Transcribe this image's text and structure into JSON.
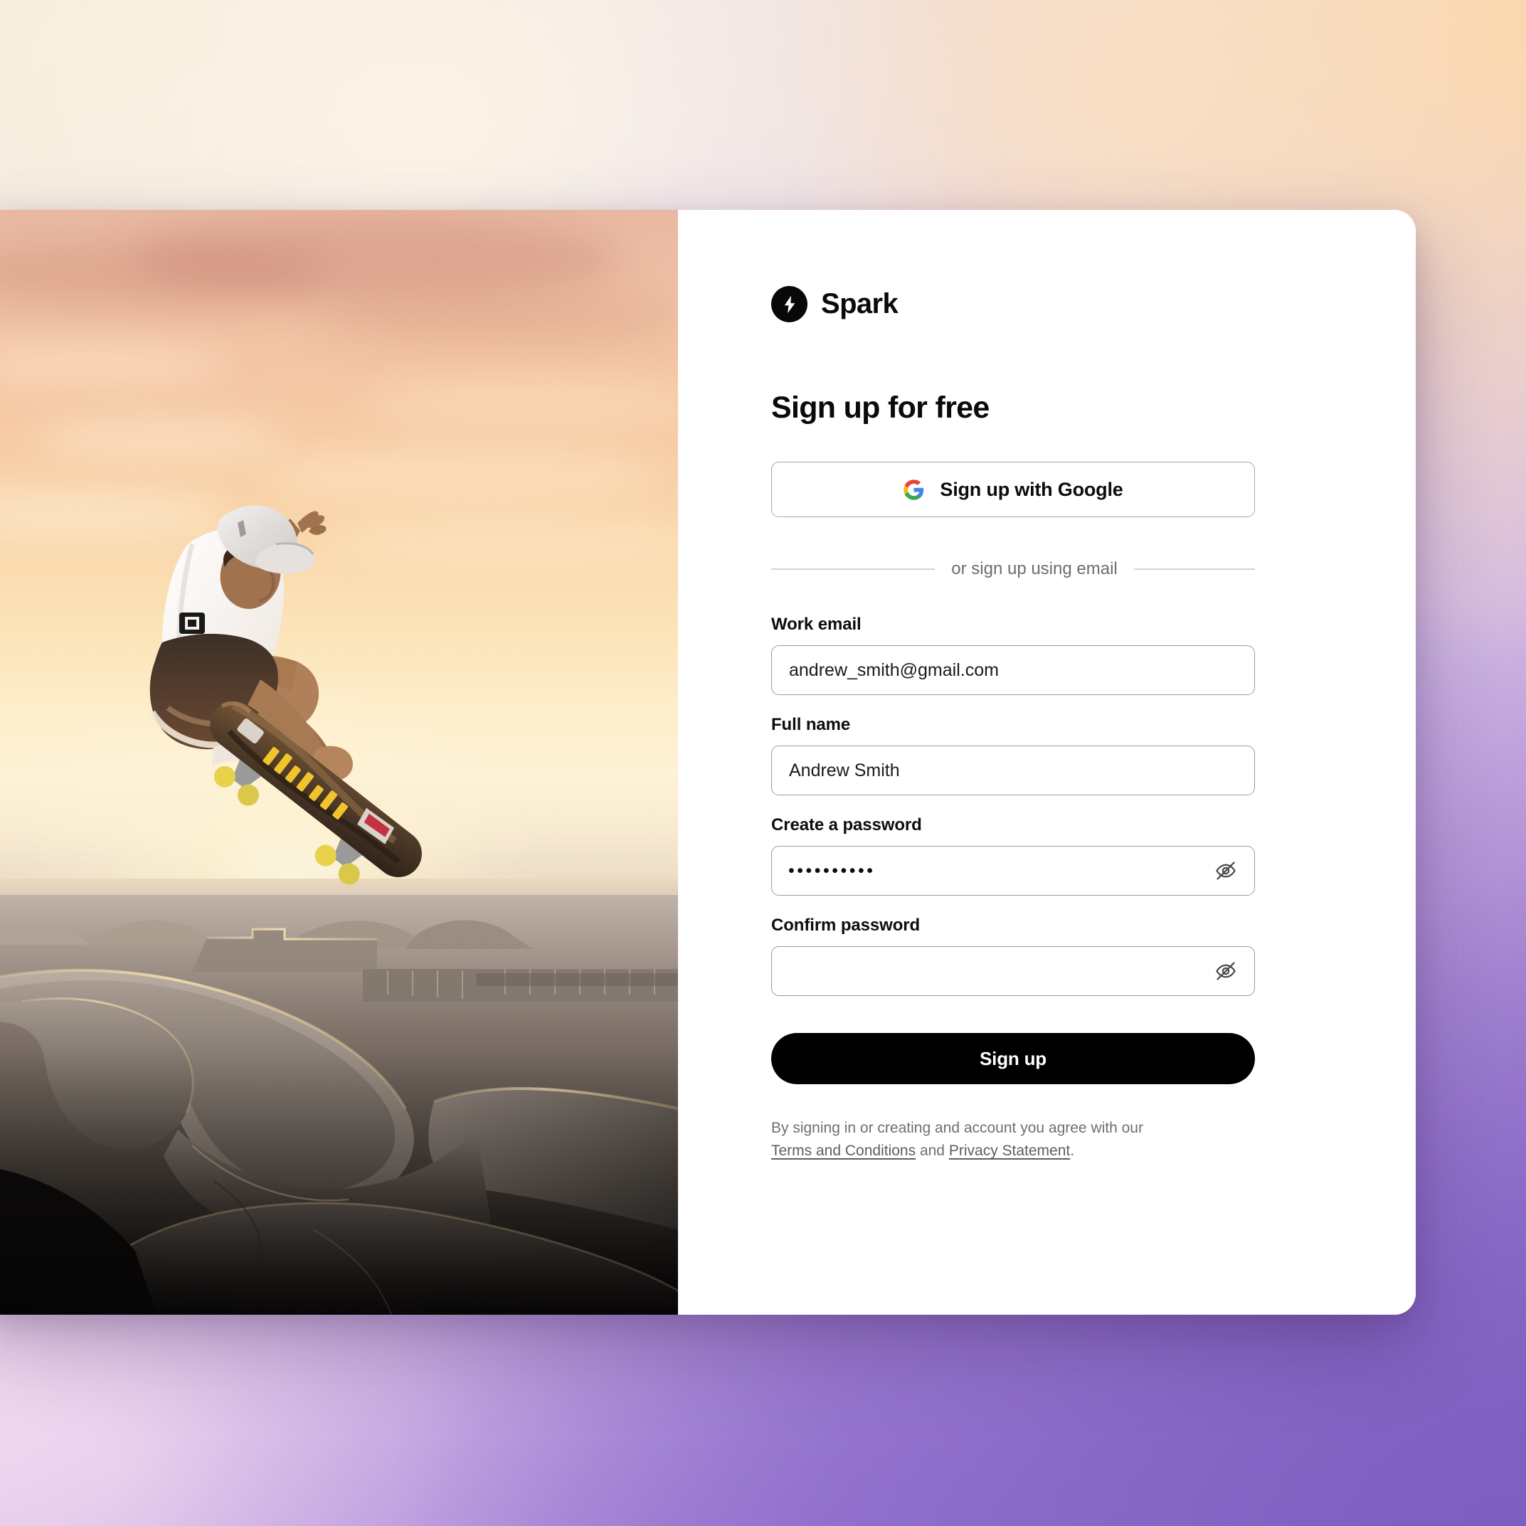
{
  "brand": {
    "name": "Spark",
    "logo_icon": "lightning-bolt-icon",
    "logo_bg": "#080808"
  },
  "page": {
    "title": "Sign up for free"
  },
  "social": {
    "google_button_label": "Sign up with Google",
    "google_icon": "google-g-icon"
  },
  "divider": {
    "text": "or sign up using email"
  },
  "form": {
    "fields": [
      {
        "id": "work-email",
        "label": "Work email",
        "value": "andrew_smith@gmail.com",
        "placeholder": "",
        "type": "email"
      },
      {
        "id": "full-name",
        "label": "Full name",
        "value": "Andrew Smith",
        "placeholder": "",
        "type": "text"
      },
      {
        "id": "create-password",
        "label": "Create a password",
        "value": "••••••••••",
        "placeholder": "",
        "type": "password",
        "toggle_icon": "eye-off-icon"
      },
      {
        "id": "confirm-password",
        "label": "Confirm password",
        "value": "",
        "placeholder": "",
        "type": "password",
        "toggle_icon": "eye-off-icon"
      }
    ],
    "submit_label": "Sign up"
  },
  "legal": {
    "intro": "By signing in or creating and account you agree with our",
    "terms_link": "Terms and Conditions",
    "conjunction": "and",
    "privacy_link": "Privacy Statement",
    "period": "."
  },
  "media": {
    "alt": "Skateboarder performing a grab trick mid-air above a concrete skate park at sunset"
  },
  "colors": {
    "accent": "#000000",
    "card_bg": "#ffffff",
    "border": "#9c9c9c",
    "muted_text": "#6f6f6f",
    "backdrop_warm": "#fbd6ac",
    "backdrop_purple": "#8a67c6"
  }
}
